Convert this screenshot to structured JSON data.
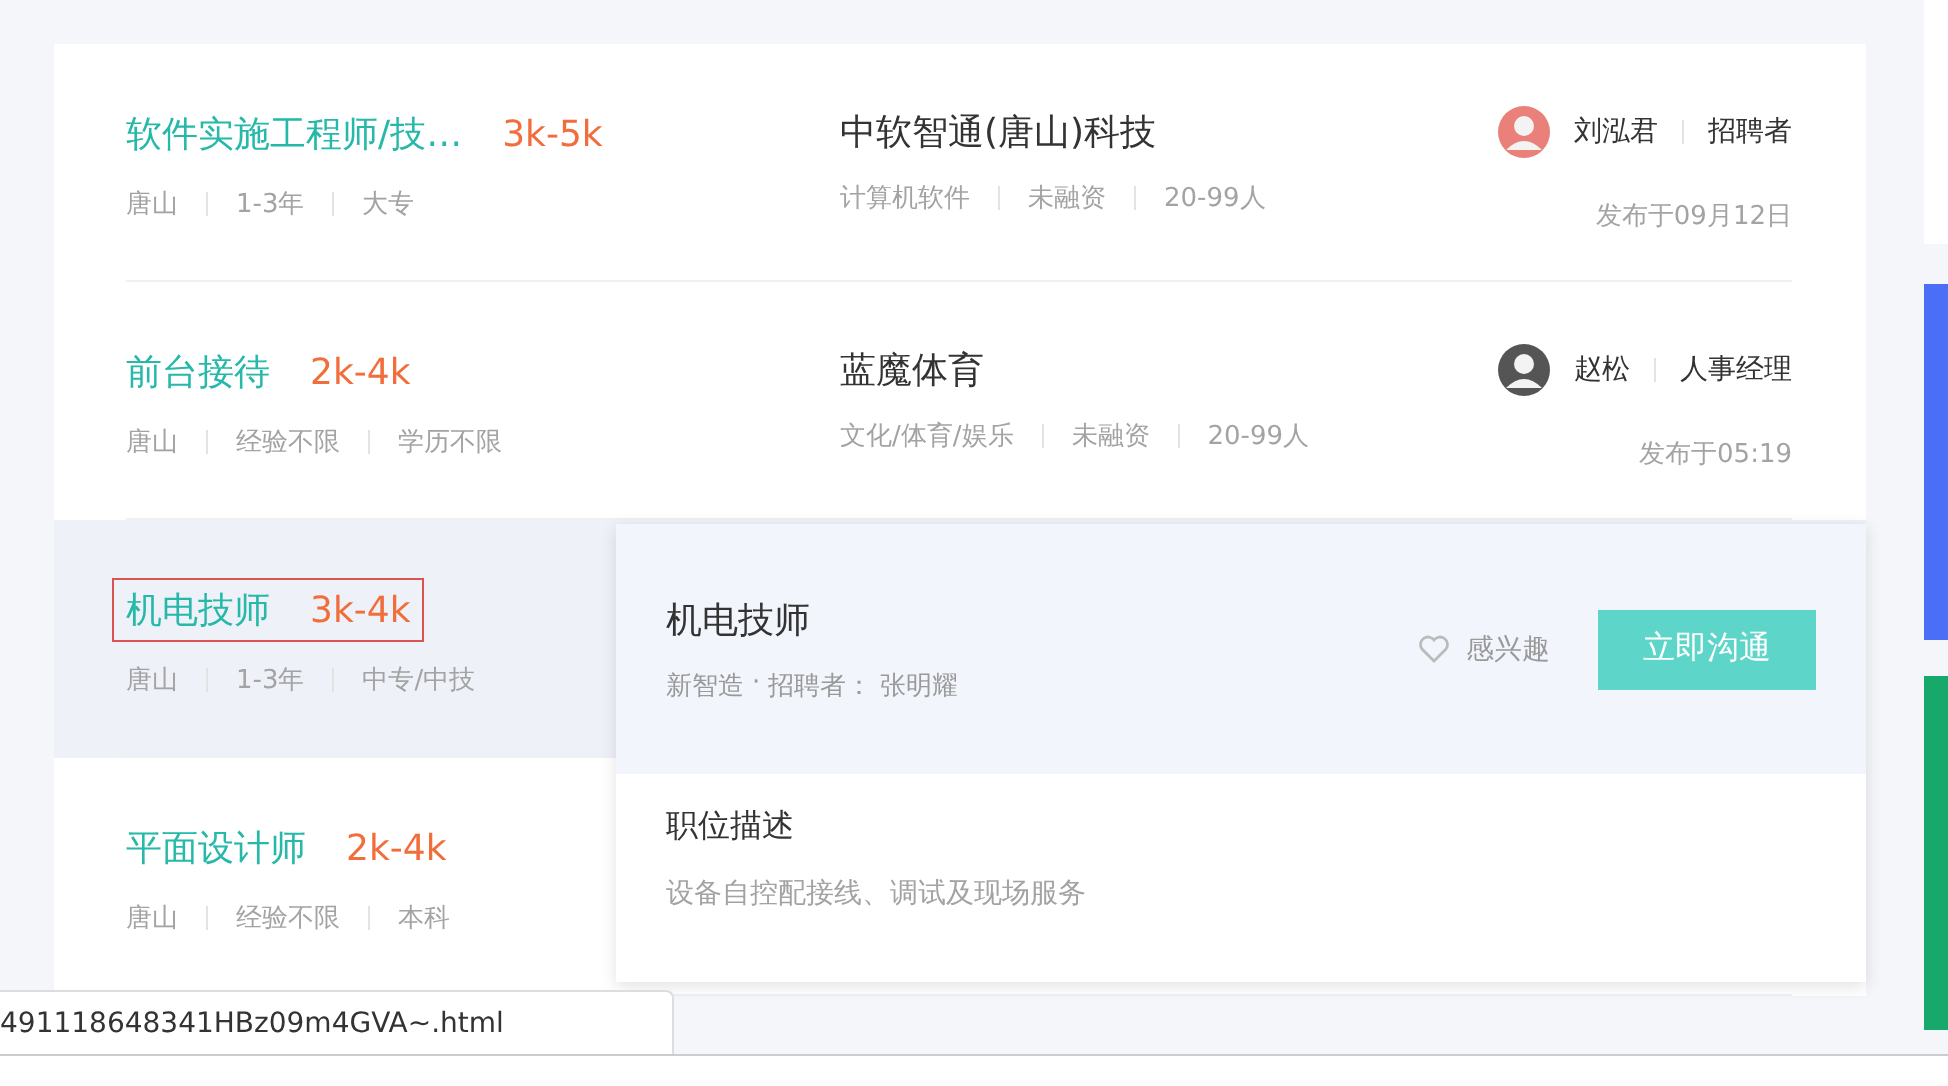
{
  "jobs": [
    {
      "title": "软件实施工程师/技…",
      "salary": "3k-5k",
      "tags": [
        "唐山",
        "1-3年",
        "大专"
      ],
      "company": "中软智通(唐山)科技",
      "company_tags": [
        "计算机软件",
        "未融资",
        "20-99人"
      ],
      "recruiter": "刘泓君",
      "role": "招聘者",
      "posted": "发布于09月12日",
      "hovered": false,
      "outlined": false
    },
    {
      "title": "前台接待",
      "salary": "2k-4k",
      "tags": [
        "唐山",
        "经验不限",
        "学历不限"
      ],
      "company": "蓝魔体育",
      "company_tags": [
        "文化/体育/娱乐",
        "未融资",
        "20-99人"
      ],
      "recruiter": "赵松",
      "role": "人事经理",
      "posted": "发布于05:19",
      "hovered": false,
      "outlined": false
    },
    {
      "title": "机电技师",
      "salary": "3k-4k",
      "tags": [
        "唐山",
        "1-3年",
        "中专/中技"
      ],
      "hovered": true,
      "outlined": true
    },
    {
      "title": "平面设计师",
      "salary": "2k-4k",
      "tags": [
        "唐山",
        "经验不限",
        "本科"
      ],
      "hovered": false,
      "outlined": false
    }
  ],
  "popup": {
    "title": "机电技师",
    "company": "新智造",
    "separator": "·",
    "recruiter_label": "招聘者：",
    "recruiter": "张明耀",
    "interest": "感兴趣",
    "chat_button": "立即沟通",
    "section_title": "职位描述",
    "description": "设备自控配接线、调试及现场服务"
  },
  "status_url": "491118648341HBz09m4GVA~.html"
}
